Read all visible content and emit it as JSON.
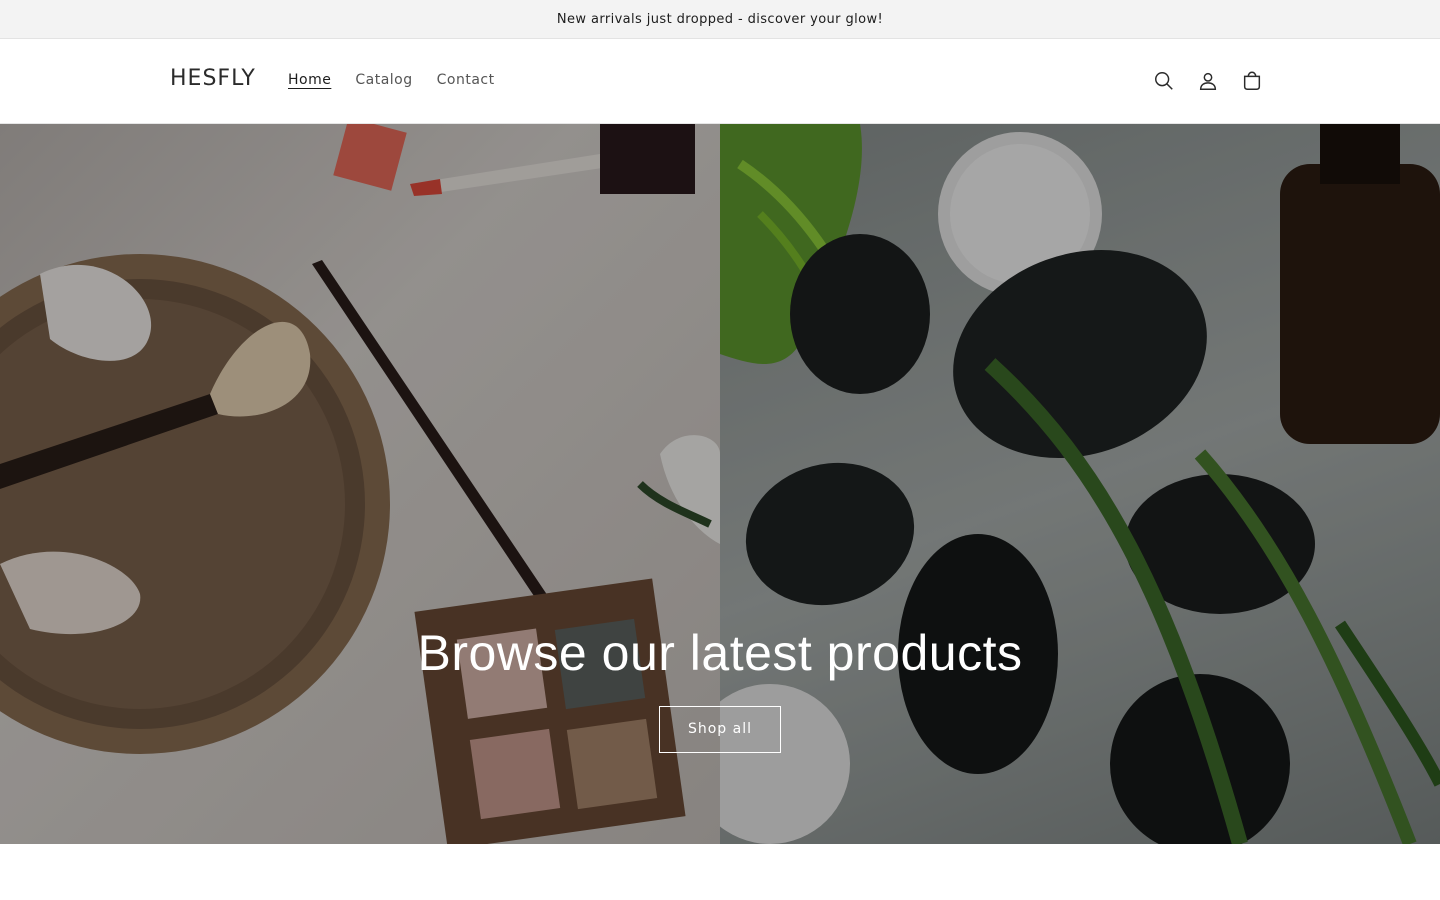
{
  "announcement": {
    "text": "New arrivals just dropped - discover your glow!"
  },
  "header": {
    "logo": "HESFLY",
    "nav": [
      {
        "label": "Home",
        "active": true
      },
      {
        "label": "Catalog",
        "active": false
      },
      {
        "label": "Contact",
        "active": false
      }
    ],
    "icons": [
      "search-icon",
      "account-icon",
      "cart-icon"
    ]
  },
  "hero": {
    "title": "Browse our latest products",
    "button_label": "Shop all",
    "left_image": "makeup-flatlay-image",
    "right_image": "spa-stones-image"
  },
  "colors": {
    "overlay": "#000000",
    "announcement_bg": "#f3f3f3",
    "text": "#121212"
  }
}
